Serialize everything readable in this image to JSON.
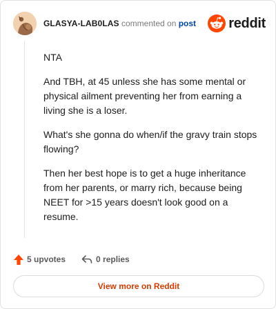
{
  "header": {
    "username": "GLASYA-LAB0LAS",
    "action_text": "commented on",
    "post_link_label": "post",
    "brand_name": "reddit"
  },
  "comment": {
    "paragraphs": [
      "NTA",
      "And TBH, at 45 unless she has some mental or physical ailment preventing her from earning a living she is a loser.",
      "What's she gonna do when/if the gravy train stops flowing?",
      "Then her best hope is to get a huge inheritance from her parents, or marry rich, because being NEET for >15 years doesn't look good on a resume."
    ]
  },
  "actions": {
    "upvotes_label": "5 upvotes",
    "replies_label": "0 replies"
  },
  "footer": {
    "view_more_label": "View more on Reddit"
  },
  "colors": {
    "brand": "#ff4500",
    "link": "#0045ac",
    "view_more_text": "#d93a00",
    "avatar_bg": "#f2d2ae"
  },
  "icons": {
    "avatar": "user-avatar",
    "brand": "reddit-snoo-icon",
    "upvote": "upvote-arrow-icon",
    "reply": "reply-arrow-icon"
  }
}
